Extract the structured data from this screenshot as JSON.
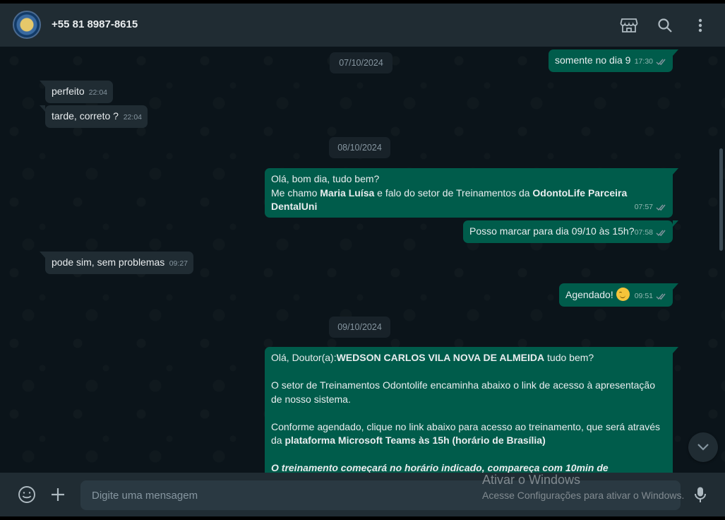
{
  "header": {
    "contact_name": "+55 81 8987-8615",
    "icons": [
      "store-icon",
      "search-icon",
      "menu-dots-icon"
    ]
  },
  "chat": {
    "dates": [
      "07/10/2024",
      "08/10/2024",
      "09/10/2024"
    ],
    "messages": [
      {
        "dir": "out",
        "text": "somente no dia 9",
        "time": "17:30",
        "status": "read"
      },
      {
        "dir": "in",
        "text": "perfeito",
        "time": "22:04"
      },
      {
        "dir": "in",
        "text": "tarde, correto ?",
        "time": "22:04"
      },
      {
        "dir": "out",
        "line1": "Olá, bom dia, tudo bem?",
        "line2_a": "Me chamo ",
        "line2_b": "Maria Luísa",
        "line2_c": " e falo do setor de Treinamentos da ",
        "line2_d": "OdontoLife Parceira DentalUni",
        "time": "07:57",
        "status": "read"
      },
      {
        "dir": "out",
        "text": "Posso marcar para dia 09/10 às 15h?",
        "time": "07:58",
        "status": "read"
      },
      {
        "dir": "in",
        "text": "pode sim, sem problemas",
        "time": "09:27"
      },
      {
        "dir": "out",
        "text": "Agendado!",
        "emoji": "relieved-face",
        "time": "09:51",
        "status": "read"
      },
      {
        "dir": "out",
        "p1_a": "Olá, Doutor(a):",
        "p1_b": "WEDSON CARLOS VILA NOVA DE ALMEIDA",
        "p1_c": " tudo bem?",
        "p2": "O setor de Treinamentos Odontolife encaminha abaixo o link de acesso à apresentação de nosso sistema.",
        "p3_a": "Conforme agendado, clique no link abaixo para acesso ao treinamento, que será através da ",
        "p3_b": "plataforma Microsoft Teams às 15h (horário de Brasília)",
        "p4": "O treinamento começará no horário indicado, compareça com 10min de"
      }
    ]
  },
  "composer": {
    "placeholder": "Digite uma mensagem",
    "icons": [
      "emoji-icon",
      "plus-icon",
      "mic-icon"
    ]
  },
  "watermark": {
    "title": "Ativar o Windows",
    "subtitle": "Acesse Configurações para ativar o Windows."
  },
  "colors": {
    "header_bg": "#202c33",
    "chat_bg": "#0b141a",
    "outgoing_bubble": "#005c4b",
    "incoming_bubble": "#202c33",
    "read_ticks": "#8696a0"
  }
}
